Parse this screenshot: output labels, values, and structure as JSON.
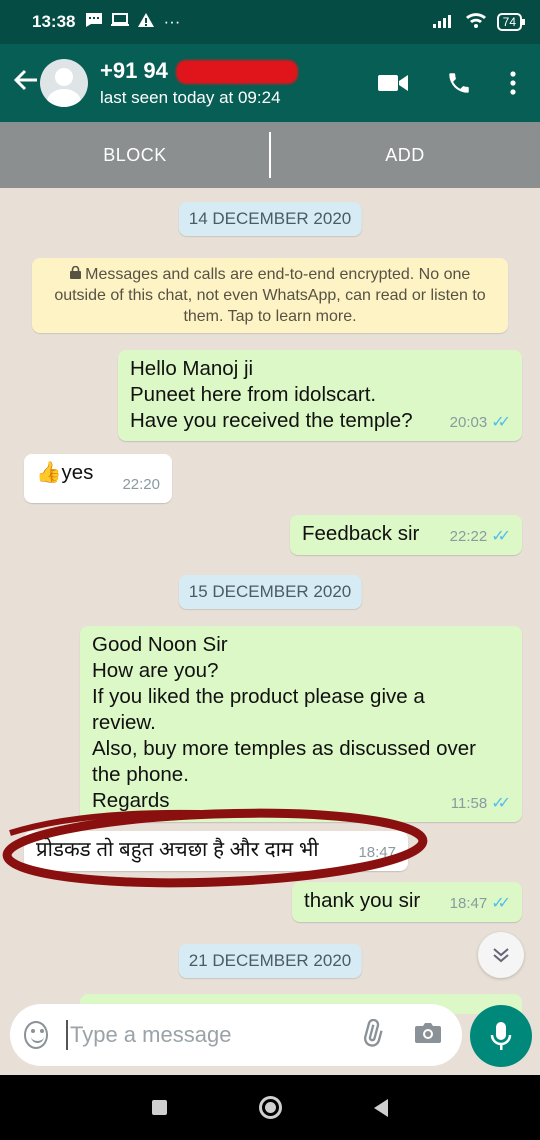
{
  "status_bar": {
    "time": "13:38",
    "battery": "74"
  },
  "header": {
    "contact_name": "+91 94",
    "last_seen": "last seen today at 09:24"
  },
  "action_bar": {
    "block_label": "BLOCK",
    "add_label": "ADD"
  },
  "chat": {
    "date_1": "14 DECEMBER 2020",
    "encryption_notice": "Messages and calls are end-to-end encrypted. No one outside of this chat, not even WhatsApp, can read or listen to them. Tap to learn more.",
    "messages": [
      {
        "direction": "out",
        "lines": [
          "Hello Manoj ji",
          "Puneet here from idolscart.",
          "Have you received the temple?"
        ],
        "time": "20:03",
        "read": true
      },
      {
        "direction": "in",
        "emoji": "👍",
        "text": "yes",
        "time": "22:20"
      },
      {
        "direction": "out",
        "lines": [
          "Feedback sir"
        ],
        "time": "22:22",
        "read": true
      },
      {
        "direction": "out",
        "lines": [
          "Good Noon Sir",
          "How are you?",
          "If you liked the product please give a",
          "review.",
          "Also, buy more temples as discussed over",
          "the phone.",
          "Regards"
        ],
        "time": "11:58",
        "read": true
      },
      {
        "direction": "in",
        "text": "प्रोडकड तो बहुत अचछा है और दाम भी",
        "time": "18:47"
      },
      {
        "direction": "out",
        "lines": [
          "thank you sir"
        ],
        "time": "18:47",
        "read": true
      }
    ],
    "date_2": "15 DECEMBER 2020",
    "date_3": "21 DECEMBER 2020"
  },
  "composer": {
    "placeholder": "Type a message"
  },
  "colors": {
    "header": "#075e54",
    "status_bar": "#054d44",
    "outgoing_bubble": "#dcf8c6",
    "read_ticks": "#53bdeb",
    "mic_button": "#00897b"
  }
}
